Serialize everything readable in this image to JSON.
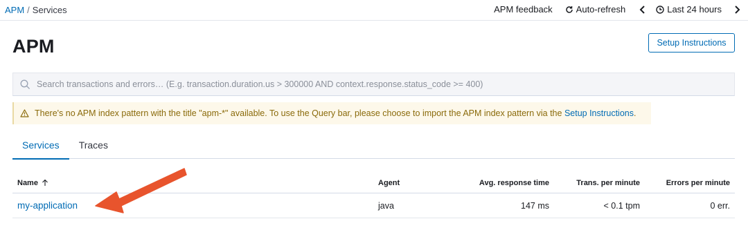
{
  "breadcrumb": {
    "root": "APM",
    "separator": "/",
    "current": "Services"
  },
  "topnav": {
    "feedback": "APM feedback",
    "auto_refresh": "Auto-refresh",
    "time_range": "Last 24 hours",
    "icons": {
      "refresh": "refresh-icon",
      "prev": "chevron-left-icon",
      "clock": "clock-icon",
      "next": "chevron-right-icon"
    }
  },
  "header": {
    "title": "APM",
    "setup_button": "Setup Instructions"
  },
  "search": {
    "placeholder": "Search transactions and errors… (E.g. transaction.duration.us > 300000 AND context.response.status_code >= 400)",
    "value": ""
  },
  "callout": {
    "text": "There's no APM index pattern with the title \"apm-*\" available. To use the Query bar, please choose to import the APM index pattern via the ",
    "link": "Setup Instructions",
    "suffix": "."
  },
  "tabs": [
    {
      "label": "Services",
      "active": true
    },
    {
      "label": "Traces",
      "active": false
    }
  ],
  "table": {
    "columns": [
      "Name",
      "Agent",
      "Avg. response time",
      "Trans. per minute",
      "Errors per minute"
    ],
    "sort": {
      "column": "Name",
      "direction": "ascending"
    },
    "rows": [
      {
        "name": "my-application",
        "agent": "java",
        "avg_response": "147 ms",
        "tpm": "< 0.1 tpm",
        "epm": "0 err."
      }
    ]
  },
  "colors": {
    "link": "#006bb4",
    "warning_bg": "#fdf8ea",
    "warning_text": "#8a6a0a",
    "annotation_arrow": "#e8542d"
  }
}
